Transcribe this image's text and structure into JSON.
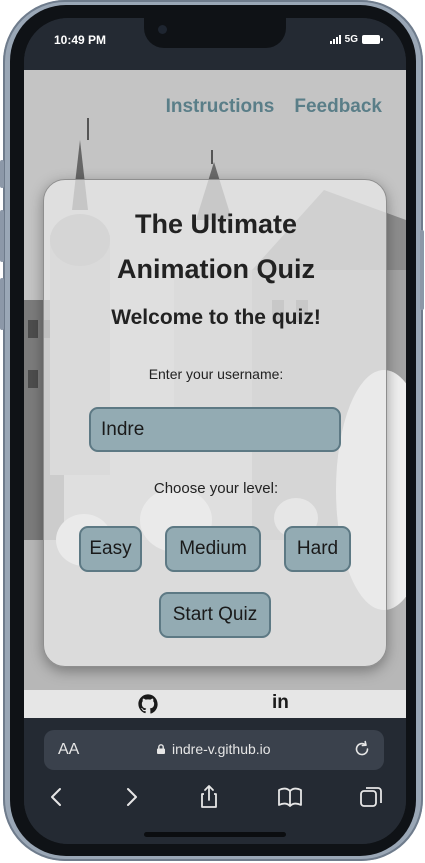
{
  "status_bar": {
    "time": "10:49 PM",
    "network": "5G"
  },
  "nav": {
    "instructions": "Instructions",
    "feedback": "Feedback"
  },
  "quiz": {
    "title_line1": "The Ultimate",
    "title_line2": "Animation Quiz",
    "welcome": "Welcome to the quiz!",
    "username_label": "Enter your username:",
    "username_value": "Indre",
    "level_label": "Choose your level:",
    "levels": [
      "Easy",
      "Medium",
      "Hard"
    ],
    "start": "Start Quiz"
  },
  "footer": {
    "linkedin": "in"
  },
  "browser": {
    "text_size": "AA",
    "url": "indre-v.github.io"
  },
  "colors": {
    "accent": "#5a7e88",
    "button_bg": "#93abb3",
    "button_border": "#5d7984"
  },
  "icons": [
    "github-icon",
    "linkedin-icon",
    "lock-icon",
    "reload-icon",
    "back-icon",
    "forward-icon",
    "share-icon",
    "bookmarks-icon",
    "tabs-icon"
  ]
}
